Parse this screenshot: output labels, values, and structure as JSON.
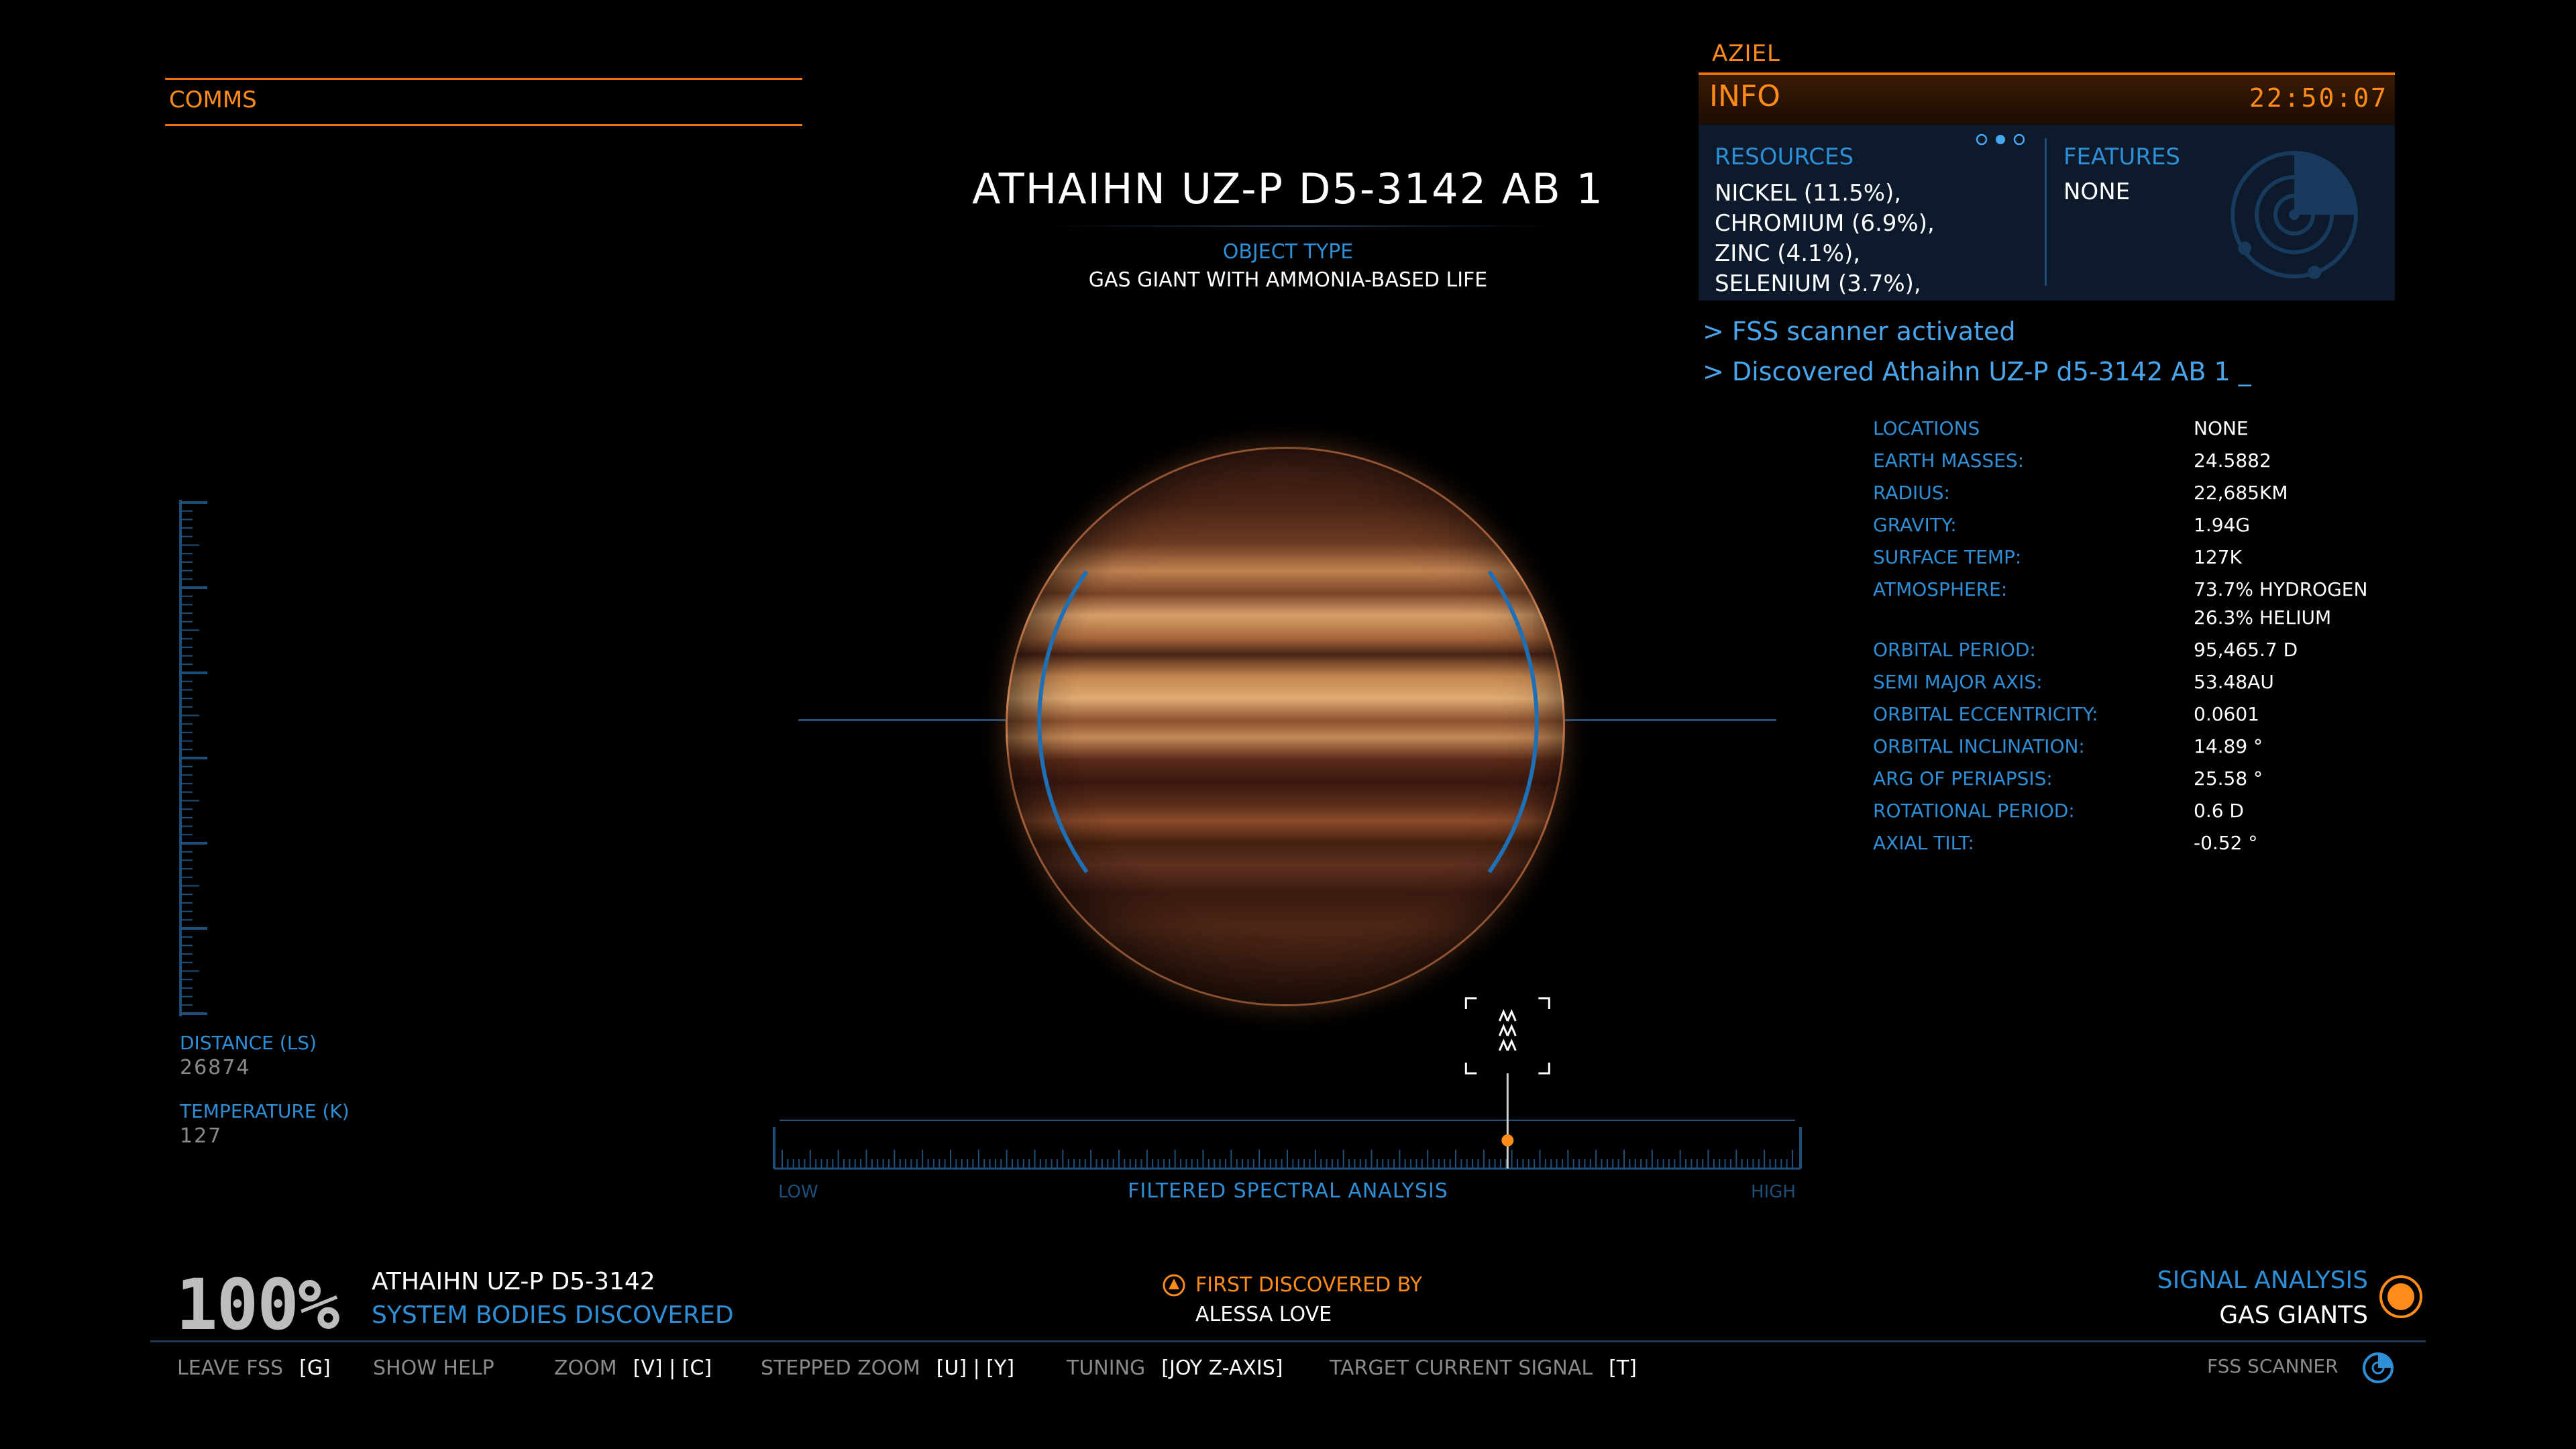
{
  "comms": {
    "label": "COMMS"
  },
  "body": {
    "name": "ATHAIHN UZ-P D5-3142 AB 1",
    "object_type_label": "OBJECT TYPE",
    "object_type": "GAS GIANT WITH AMMONIA-BASED LIFE"
  },
  "left_gauge": {
    "distance_label": "DISTANCE (LS)",
    "distance_value": "26874",
    "temperature_label": "TEMPERATURE (K)",
    "temperature_value": "127"
  },
  "spectrum": {
    "low_label": "LOW",
    "high_label": "HIGH",
    "title": "FILTERED SPECTRAL ANALYSIS",
    "marker_position": 0.718
  },
  "info_panel": {
    "commander": "AZIEL",
    "title": "INFO",
    "time": "22:50:07",
    "resources_label": "RESOURCES",
    "resources": [
      "NICKEL (11.5%),",
      "CHROMIUM (6.9%),",
      "ZINC (4.1%),",
      "SELENIUM (3.7%),"
    ],
    "features_label": "FEATURES",
    "features_value": "NONE",
    "page_count": 3,
    "active_page": 2
  },
  "log": {
    "line1": "> FSS scanner activated",
    "line2": "> Discovered Athaihn UZ-P d5-3142 AB 1  _"
  },
  "stats": {
    "locations": {
      "label": "LOCATIONS",
      "value": "NONE"
    },
    "earth_masses": {
      "label": "EARTH MASSES:",
      "value": "24.5882"
    },
    "radius": {
      "label": "RADIUS:",
      "value": "22,685KM"
    },
    "gravity": {
      "label": "GRAVITY:",
      "value": "1.94G"
    },
    "surface_temp": {
      "label": "SURFACE TEMP:",
      "value": "127K"
    },
    "atmosphere": {
      "label": "ATMOSPHERE:",
      "value": "73.7% HYDROGEN",
      "value2": "26.3% HELIUM"
    },
    "orbital_period": {
      "label": "ORBITAL PERIOD:",
      "value": "95,465.7 D"
    },
    "semi_major_axis": {
      "label": "SEMI MAJOR AXIS:",
      "value": "53.48AU"
    },
    "orbital_eccentricity": {
      "label": "ORBITAL ECCENTRICITY:",
      "value": "0.0601"
    },
    "orbital_inclination": {
      "label": "ORBITAL INCLINATION:",
      "value": "14.89 °"
    },
    "arg_of_periapsis": {
      "label": "ARG OF PERIAPSIS:",
      "value": "25.58 °"
    },
    "rotational_period": {
      "label": "ROTATIONAL PERIOD:",
      "value": "0.6 D"
    },
    "axial_tilt": {
      "label": "AXIAL TILT:",
      "value": "-0.52 °"
    }
  },
  "bottom": {
    "percent": "100%",
    "system_name": "ATHAIHN UZ-P D5-3142",
    "system_discovered": "SYSTEM BODIES DISCOVERED",
    "first_discovered_label": "FIRST DISCOVERED BY",
    "first_discovered_name": "ALESSA LOVE",
    "signal_label": "SIGNAL ANALYSIS",
    "signal_value": "GAS GIANTS",
    "fss_label": "FSS SCANNER"
  },
  "help": {
    "leave_fss": {
      "label": "LEAVE FSS",
      "key": "[G]"
    },
    "show_help": {
      "label": "SHOW HELP"
    },
    "zoom": {
      "label": "ZOOM",
      "key": "[V] | [C]"
    },
    "stepped_zoom": {
      "label": "STEPPED ZOOM",
      "key": "[U] | [Y]"
    },
    "tuning": {
      "label": "TUNING",
      "key": "[JOY Z-AXIS]"
    },
    "target_signal": {
      "label": "TARGET CURRENT SIGNAL",
      "key": "[T]"
    }
  },
  "colors": {
    "accent_orange": "#ff8c1a",
    "hud_blue": "#2e8fd6",
    "panel_bg": "#0c1a2c"
  }
}
